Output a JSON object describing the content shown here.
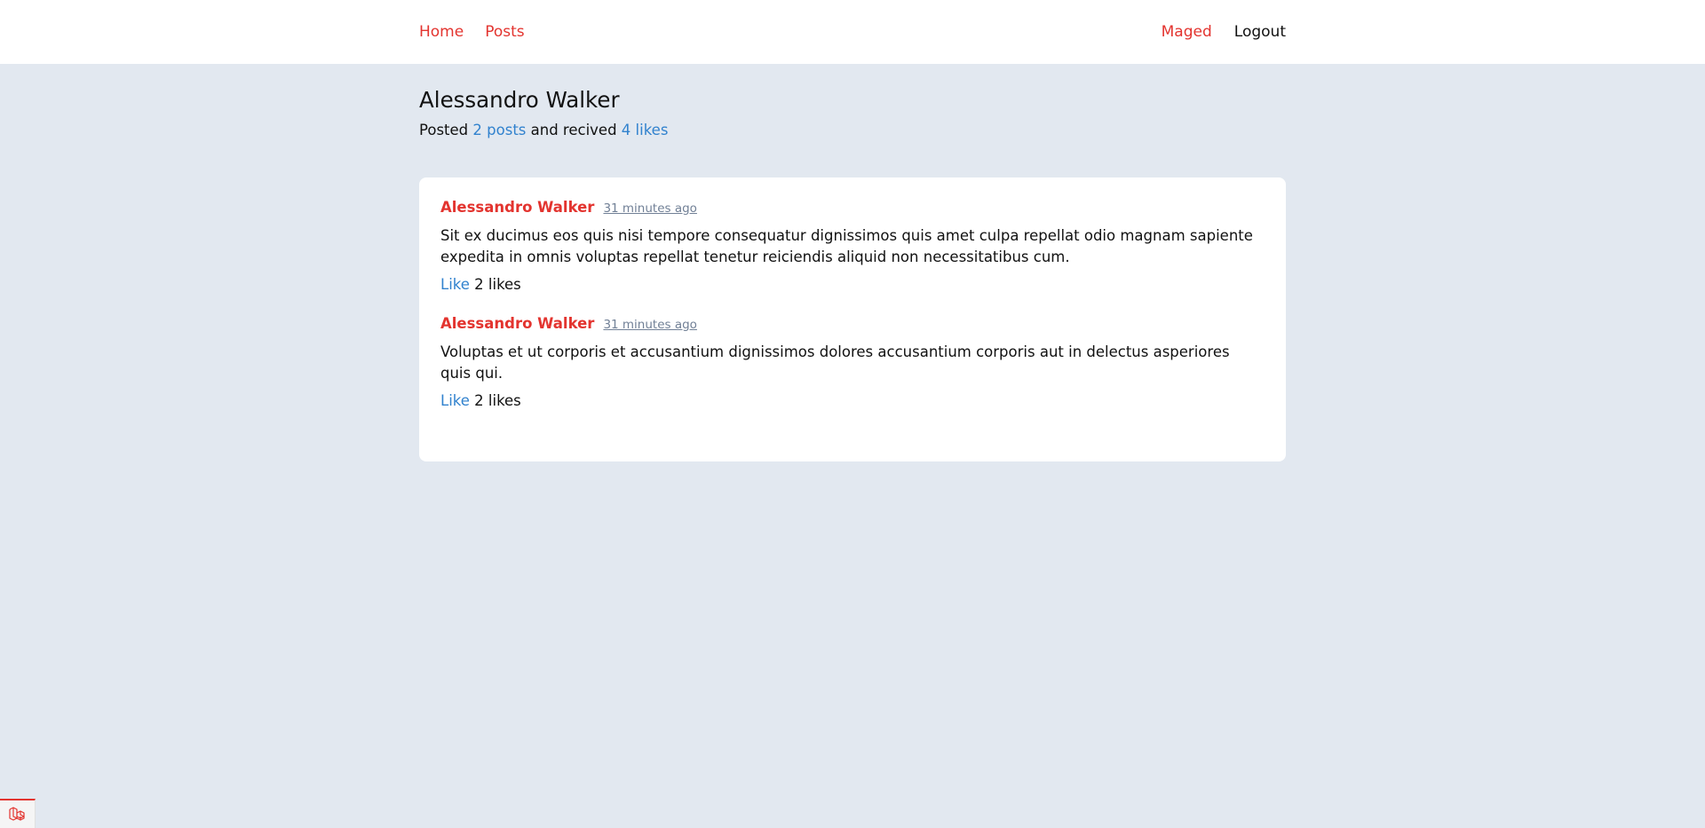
{
  "nav": {
    "home_label": "Home",
    "posts_label": "Posts",
    "user_label": "Maged",
    "logout_label": "Logout"
  },
  "profile": {
    "name": "Alessandro Walker",
    "stats_prefix": "Posted",
    "posts_count": "2 posts",
    "stats_middle": "and recived",
    "likes_count": "4 likes"
  },
  "posts": [
    {
      "author": "Alessandro Walker",
      "time": "31 minutes ago",
      "body": "Sit ex ducimus eos quis nisi tempore consequatur dignissimos quis amet culpa repellat odio magnam sapiente expedita in omnis voluptas repellat tenetur reiciendis aliquid non necessitatibus cum.",
      "like_label": "Like",
      "likes": "2 likes"
    },
    {
      "author": "Alessandro Walker",
      "time": "31 minutes ago",
      "body": "Voluptas et ut corporis et accusantium dignissimos dolores accusantium corporis aut in delectus asperiores quis qui.",
      "like_label": "Like",
      "likes": "2 likes"
    }
  ],
  "colors": {
    "background": "#e2e8f0",
    "accent_red": "#e3342f",
    "link_blue": "#3182ce",
    "muted": "#718096"
  },
  "icons": {
    "debug_tab": "laravel-logo-icon"
  }
}
